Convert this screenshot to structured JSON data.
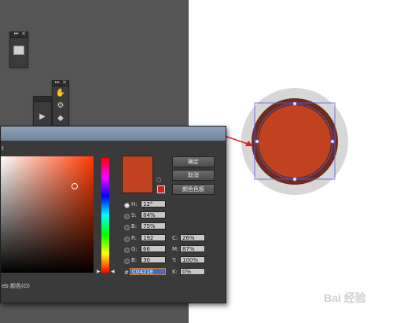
{
  "dialog": {
    "title_fragment": "t",
    "preview_hex": "#C0421E",
    "buttons": {
      "ok": "确定",
      "cancel": "取消",
      "swatches": "颜色色板"
    },
    "hsb": {
      "h_label": "H:",
      "h_value": "12°",
      "s_label": "S:",
      "s_value": "84%",
      "b_label": "B:",
      "b_value": "75%"
    },
    "rgb": {
      "r_label": "R:",
      "r_value": "192",
      "g_label": "G:",
      "g_value": "66",
      "b_label": "B:",
      "b_value": "30"
    },
    "cmyk": {
      "c_label": "C:",
      "c_value": "26%",
      "m_label": "M:",
      "m_value": "87%",
      "y_label": "Y:",
      "y_value": "100%",
      "k_label": "K:",
      "k_value": "0%"
    },
    "hex_label": "#",
    "hex_value": "C0421E",
    "web_only_label": "eb 颜色(O)"
  },
  "panels": {
    "close_glyph": "✕",
    "collapse_glyph": "▸▸"
  },
  "colors": {
    "circle_fill": "#C0421E",
    "circle_ring": "#6E2D1C",
    "halo": "#D7D7D7",
    "arrow": "#E02020",
    "selection": "#5A5AE0"
  },
  "watermark": "Bai 经验"
}
